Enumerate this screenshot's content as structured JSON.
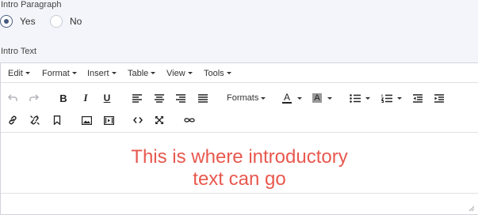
{
  "form": {
    "intro_paragraph_label": "Intro Paragraph",
    "radio_yes": "Yes",
    "radio_no": "No",
    "selected": "Yes",
    "intro_text_label": "Intro Text"
  },
  "menubar": {
    "edit": "Edit",
    "format": "Format",
    "insert": "Insert",
    "table": "Table",
    "view": "View",
    "tools": "Tools"
  },
  "toolbar": {
    "formats": "Formats",
    "font_color_letter": "A",
    "bg_color_letter": "A",
    "bold_letter": "B",
    "italic_letter": "I",
    "underline_letter": "U"
  },
  "content": {
    "line1": "This is where introductory",
    "line2": "text can go"
  },
  "colors": {
    "content_text": "#e8584e",
    "radio_selected": "#43587c",
    "background": "#f4f5fa"
  }
}
